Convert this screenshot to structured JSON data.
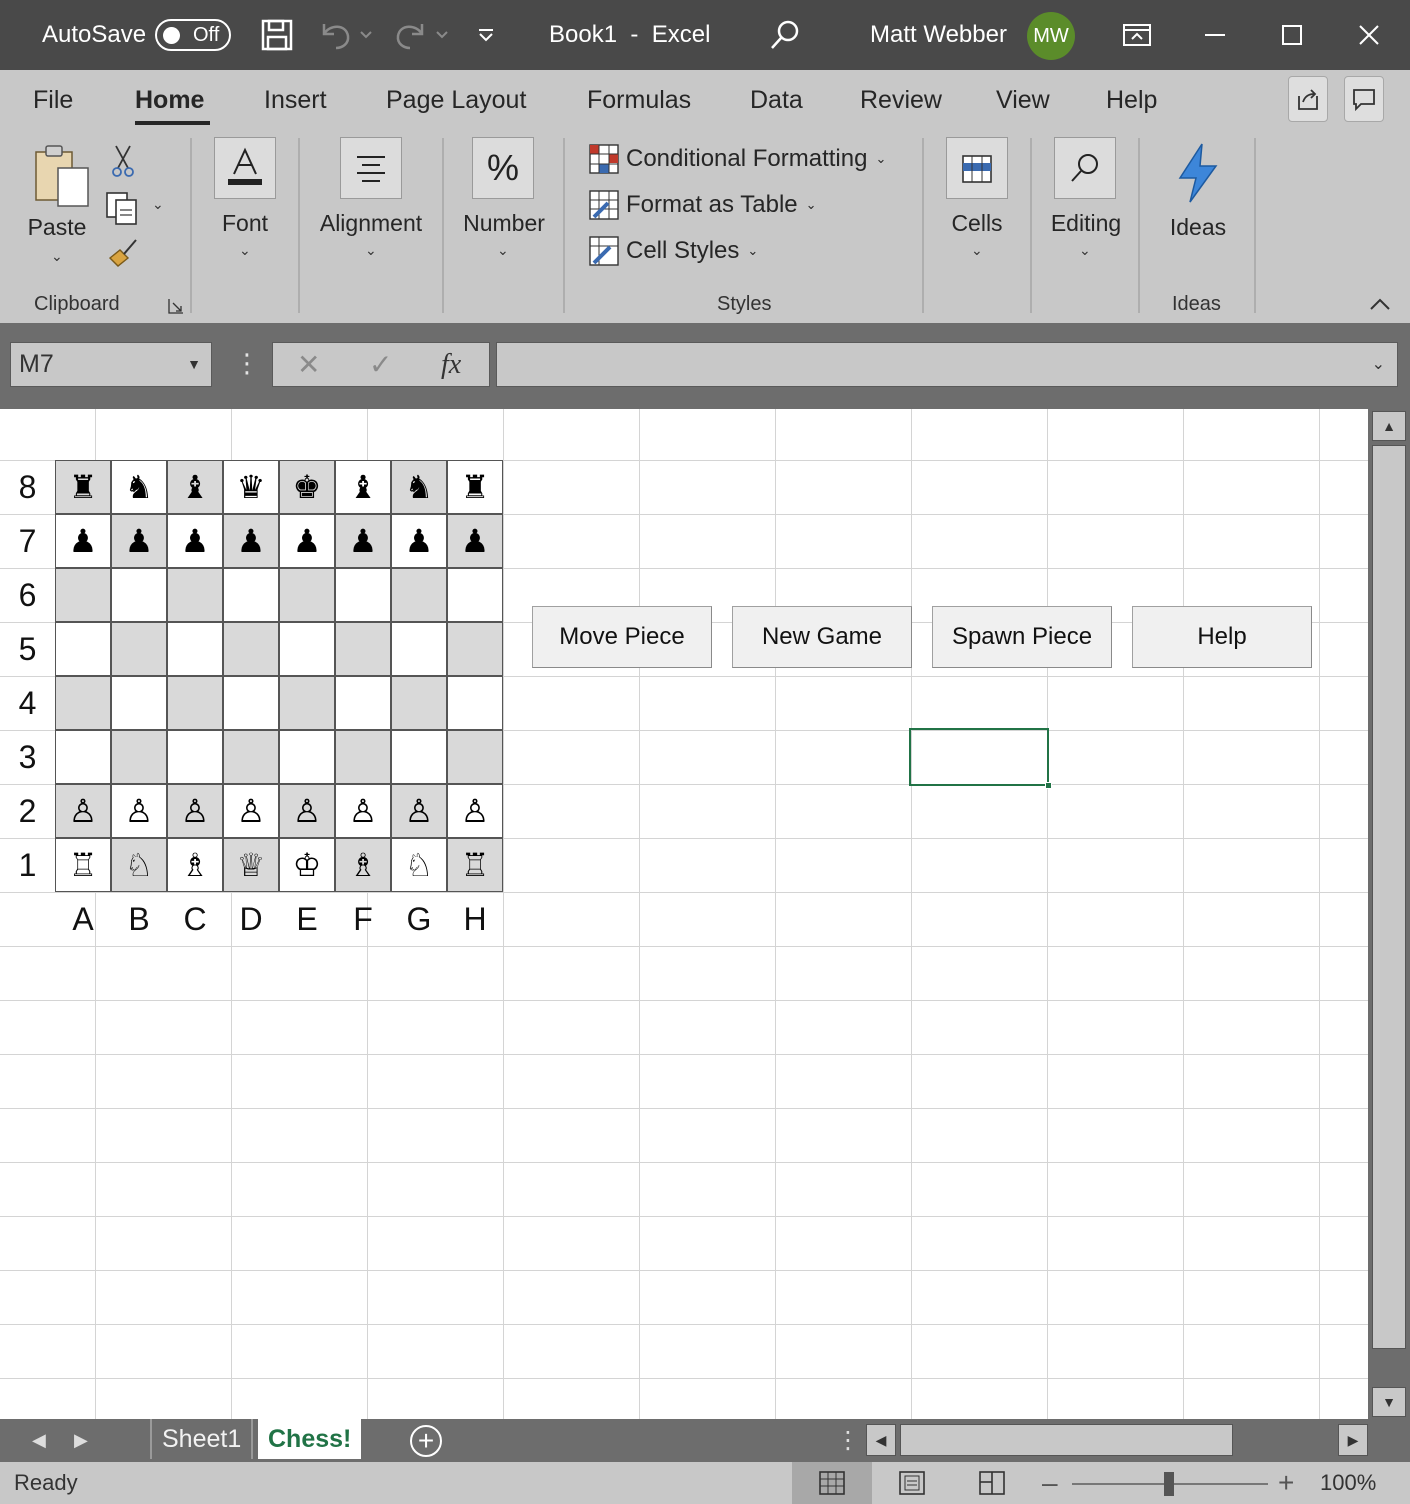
{
  "titlebar": {
    "autosave_label": "AutoSave",
    "autosave_state": "Off",
    "document_title": "Book1  -  Excel",
    "user_name": "Matt Webber",
    "user_initials": "MW",
    "avatar_color": "#5b8c2a"
  },
  "ribbon": {
    "tabs": [
      "File",
      "Home",
      "Insert",
      "Page Layout",
      "Formulas",
      "Data",
      "Review",
      "View",
      "Help"
    ],
    "active_tab": "Home",
    "clipboard": {
      "paste_label": "Paste",
      "group_label": "Clipboard"
    },
    "font_label": "Font",
    "alignment_label": "Alignment",
    "number_label": "Number",
    "styles": {
      "conditional_formatting": "Conditional Formatting",
      "format_as_table": "Format as Table",
      "cell_styles": "Cell Styles",
      "group_label": "Styles"
    },
    "cells_label": "Cells",
    "editing_label": "Editing",
    "ideas": {
      "button_label": "Ideas",
      "group_label": "Ideas"
    }
  },
  "formula_bar": {
    "name_box": "M7",
    "fx_label": "fx",
    "formula_value": ""
  },
  "board": {
    "ranks": [
      "8",
      "7",
      "6",
      "5",
      "4",
      "3",
      "2",
      "1"
    ],
    "files": [
      "A",
      "B",
      "C",
      "D",
      "E",
      "F",
      "G",
      "H"
    ],
    "rows": [
      [
        "♜",
        "♞",
        "♝",
        "♛",
        "♚",
        "♝",
        "♞",
        "♜"
      ],
      [
        "♟",
        "♟",
        "♟",
        "♟",
        "♟",
        "♟",
        "♟",
        "♟"
      ],
      [
        "",
        "",
        "",
        "",
        "",
        "",
        "",
        ""
      ],
      [
        "",
        "",
        "",
        "",
        "",
        "",
        "",
        ""
      ],
      [
        "",
        "",
        "",
        "",
        "",
        "",
        "",
        ""
      ],
      [
        "",
        "",
        "",
        "",
        "",
        "",
        "",
        ""
      ],
      [
        "♙",
        "♙",
        "♙",
        "♙",
        "♙",
        "♙",
        "♙",
        "♙"
      ],
      [
        "♖",
        "♘",
        "♗",
        "♕",
        "♔",
        "♗",
        "♘",
        "♖"
      ]
    ],
    "dark_color": "#d9d9d9",
    "light_color": "#ffffff"
  },
  "buttons": {
    "move_piece": "Move Piece",
    "new_game": "New Game",
    "spawn_piece": "Spawn Piece",
    "help": "Help"
  },
  "sheets": {
    "tabs": [
      "Sheet1",
      "Chess!"
    ],
    "active": "Chess!"
  },
  "status": {
    "text": "Ready",
    "zoom": "100%"
  }
}
